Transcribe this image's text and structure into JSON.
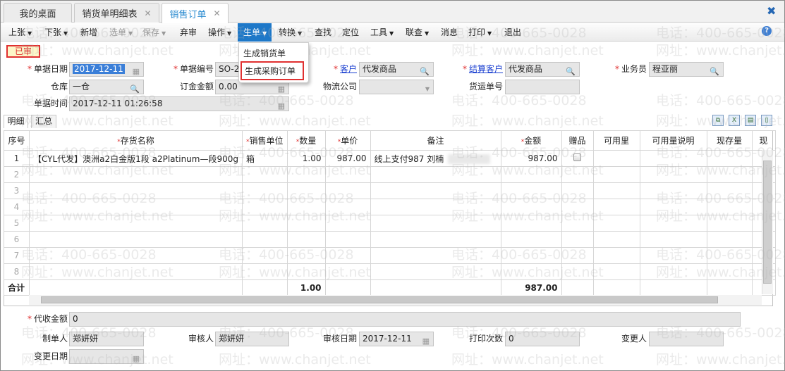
{
  "tabs": [
    {
      "label": "我的桌面"
    },
    {
      "label": "销货单明细表"
    },
    {
      "label": "销售订单"
    }
  ],
  "toolbar": {
    "items": [
      "上张",
      "下张",
      "新增",
      "选单",
      "保存",
      "弃审",
      "操作",
      "生单",
      "转换",
      "查找",
      "定位",
      "工具",
      "联查",
      "消息",
      "打印",
      "退出"
    ]
  },
  "dropdown": {
    "items": [
      "生成销货单",
      "生成采购订单"
    ]
  },
  "status_badge": "已审",
  "form": {
    "doc_date_label": "单据日期",
    "doc_date": "2017-12-11",
    "doc_no_label": "单据编号",
    "doc_no": "SO-20",
    "customer_label": "客户",
    "customer": "代发商品",
    "settle_customer_label": "结算客户",
    "settle_customer": "代发商品",
    "salesman_label": "业务员",
    "salesman": "程亚丽",
    "warehouse_label": "仓库",
    "warehouse": "一仓",
    "deposit_label": "订金金额",
    "deposit": "0.00",
    "logistics_label": "物流公司",
    "logistics": "",
    "waybill_label": "货运单号",
    "waybill": "",
    "doc_time_label": "单据时间",
    "doc_time": "2017-12-11 01:26:58"
  },
  "subtabs": [
    "明细",
    "汇总"
  ],
  "grid": {
    "columns": [
      "序号",
      "存货名称",
      "销售单位",
      "数量",
      "单价",
      "备注",
      "金额",
      "赠品",
      "可用里",
      "可用量说明",
      "现存量",
      "现"
    ],
    "rows": [
      {
        "no": "1",
        "name": "【CYL代发】澳洲a2白金版1段 a2Platinum—段900g",
        "unit": "箱",
        "qty": "1.00",
        "price": "987.00",
        "remark": "线上支付987 刘楠",
        "amount": "987.00"
      },
      {
        "no": "2"
      },
      {
        "no": "3"
      },
      {
        "no": "4"
      },
      {
        "no": "5"
      },
      {
        "no": "6"
      },
      {
        "no": "7"
      },
      {
        "no": "8"
      }
    ],
    "total_label": "合计",
    "total_qty": "1.00",
    "total_amount": "987.00"
  },
  "footer": {
    "collect_label": "代收金额",
    "collect": "0",
    "maker_label": "制单人",
    "maker": "郑妍妍",
    "auditor_label": "审核人",
    "auditor": "郑妍妍",
    "audit_date_label": "审核日期",
    "audit_date": "2017-12-11",
    "print_count_label": "打印次数",
    "print_count": "0",
    "changer_label": "变更人",
    "changer": "",
    "change_date_label": "变更日期",
    "change_date": ""
  },
  "watermark": {
    "phone": "电话：400-665-0028",
    "web": "网址：www.chanjet.net"
  }
}
